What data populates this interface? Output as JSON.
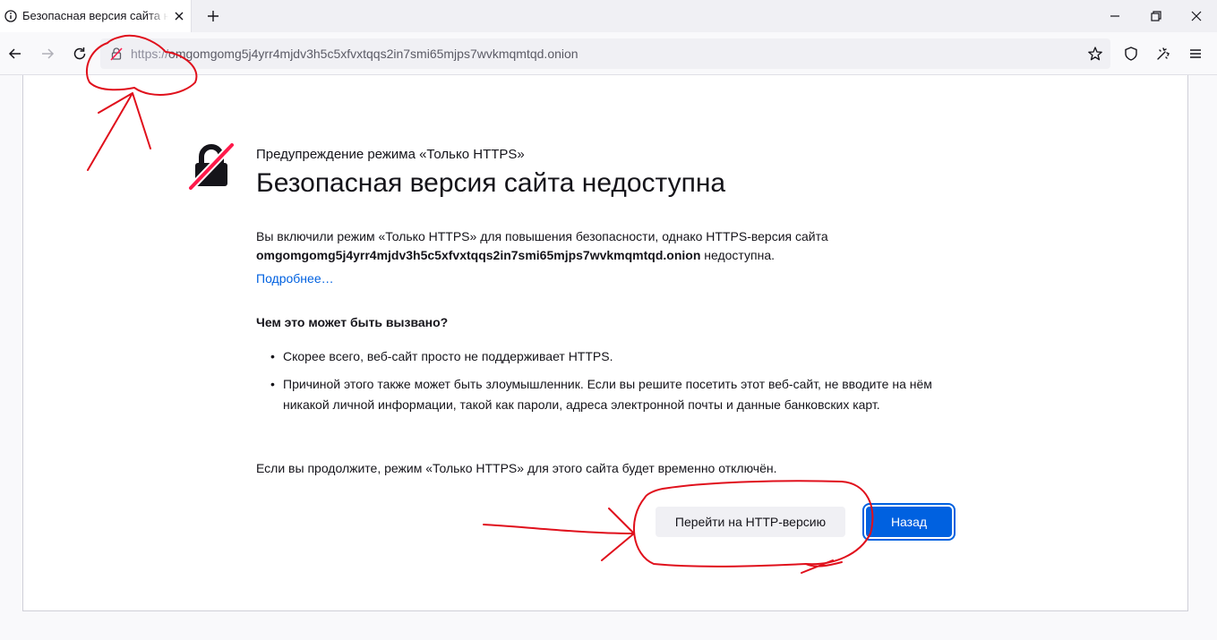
{
  "tab": {
    "title": "Безопасная версия сайта недоступна"
  },
  "urlbar": {
    "scheme": "https://",
    "host": "omgomgomg5j4yrr4mjdv3h5c5xfvxtqqs2in7smi65mjps7wvkmqmtqd.onion"
  },
  "icons": {
    "tab": "info-icon",
    "back": "back-arrow-icon",
    "forward": "forward-arrow-icon",
    "reload": "reload-icon",
    "lock": "broken-lock-icon",
    "star": "star-icon",
    "shield": "shield-icon",
    "extensions": "puzzle-icon",
    "menu": "hamburger-menu-icon",
    "big": "broken-lock-icon"
  },
  "colors": {
    "accent": "#0061e0",
    "annotation": "#e0101c",
    "lock_strike": "#ff1a4b"
  },
  "page": {
    "eyebrow": "Предупреждение режима «Только HTTPS»",
    "title": "Безопасная версия сайта недоступна",
    "para_before": "Вы включили режим «Только HTTPS» для повышения безопасности, однако HTTPS-версия сайта",
    "para_host": "omgomgomg5j4yrr4mjdv3h5c5xfvxtqqs2in7smi65mjps7wvkmqmtqd.onion",
    "para_after": "недоступна.",
    "learn_more": "Подробнее…",
    "reasons_heading": "Чем это может быть вызвано?",
    "reasons": [
      "Скорее всего, веб-сайт просто не поддерживает HTTPS.",
      "Причиной этого также может быть злоумышленник. Если вы решите посетить этот веб-сайт, не вводите на нём никакой личной информации, такой как пароли, адреса электронной почты и данные банковских карт."
    ],
    "continue_note": "Если вы продолжите, режим «Только HTTPS» для этого сайта будет временно отключён.",
    "buttons": {
      "continue_http": "Перейти на HTTP-версию",
      "back": "Назад"
    }
  }
}
